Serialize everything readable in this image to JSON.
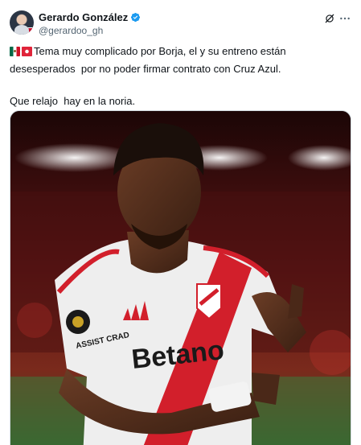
{
  "author": {
    "display_name": "Gerardo González",
    "handle": "@gerardoo_gh"
  },
  "tweet": {
    "line1": "Tema muy complicado por Borja, el y su entreno están",
    "line2": "desesperados  por no poder firmar contrato con Cruz Azul.",
    "line3": "Que relajo  hay en la noria."
  },
  "icons": {
    "verified": "verified-badge-icon",
    "grok": "grok-icon",
    "more": "more-options-icon",
    "flag_1": "mexico-flag-icon",
    "flag_2": "red-emblem-icon"
  },
  "colors": {
    "verified_blue": "#1d9bf0",
    "text": "#0f1419",
    "secondary_text": "#536471",
    "jersey_red": "#d21f2b"
  },
  "media": {
    "jersey_sponsor": "Betano",
    "jersey_sleeve": "ASSIST CRAD"
  }
}
